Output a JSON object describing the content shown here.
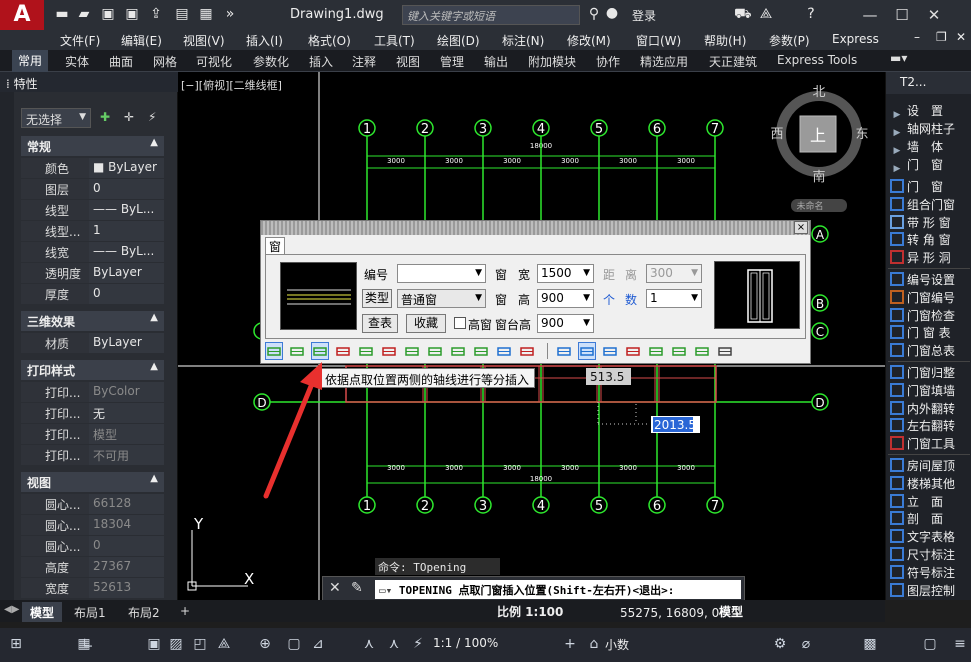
{
  "app": {
    "logo": "A",
    "doc_title": "Drawing1.dwg",
    "search_placeholder": "键入关键字或短语",
    "login": "登录"
  },
  "menu": [
    "文件(F)",
    "编辑(E)",
    "视图(V)",
    "插入(I)",
    "格式(O)",
    "工具(T)",
    "绘图(D)",
    "标注(N)",
    "修改(M)",
    "窗口(W)",
    "帮助(H)",
    "参数(P)",
    "Express"
  ],
  "ribbon_tabs": [
    "常用",
    "实体",
    "曲面",
    "网格",
    "可视化",
    "参数化",
    "插入",
    "注释",
    "视图",
    "管理",
    "输出",
    "附加模块",
    "协作",
    "精选应用",
    "天正建筑",
    "Express Tools"
  ],
  "properties": {
    "title": "特性",
    "selection": "无选择",
    "sections": [
      {
        "name": "常规",
        "rows": [
          [
            "颜色",
            "■ ByLayer"
          ],
          [
            "图层",
            "0"
          ],
          [
            "线型",
            "—— ByL..."
          ],
          [
            "线型...",
            "1"
          ],
          [
            "线宽",
            "—— ByL..."
          ],
          [
            "透明度",
            "ByLayer"
          ],
          [
            "厚度",
            "0"
          ]
        ]
      },
      {
        "name": "三维效果",
        "rows": [
          [
            "材质",
            "ByLayer"
          ]
        ]
      },
      {
        "name": "打印样式",
        "rows": [
          [
            "打印...",
            "ByColor"
          ],
          [
            "打印...",
            "无"
          ],
          [
            "打印...",
            "模型"
          ],
          [
            "打印...",
            "不可用"
          ]
        ]
      },
      {
        "name": "视图",
        "rows": [
          [
            "圆心...",
            "66128"
          ],
          [
            "圆心...",
            "18304"
          ],
          [
            "圆心...",
            "0"
          ],
          [
            "高度",
            "27367"
          ],
          [
            "宽度",
            "52613"
          ]
        ]
      }
    ]
  },
  "canvas": {
    "view_label": "[−][俯视][二维线框]",
    "viewcube": {
      "n": "北",
      "s": "南",
      "e": "东",
      "w": "西",
      "top": "上",
      "ucs": "未命名"
    },
    "axes_numbers": [
      "1",
      "2",
      "3",
      "4",
      "5",
      "6",
      "7"
    ],
    "axes_letters_right": [
      "A",
      "B",
      "C"
    ],
    "axis_letter_d": "D",
    "bay": "3000",
    "total": "18000",
    "dim1": "513.5",
    "dim2": "2013.5",
    "ucs_y": "Y",
    "ucs_x": "X"
  },
  "dialog": {
    "tab": "窗",
    "number_label": "编号",
    "number_value": "",
    "width_label1": "窗",
    "width_label2": "宽",
    "width_value": "1500",
    "dist_label1": "距",
    "dist_label2": "离",
    "dist_value": "300",
    "type_button": "类型",
    "type_value": "普通窗",
    "height_label1": "窗",
    "height_label2": "高",
    "height_value": "900",
    "count_label1": "个",
    "count_label2": "数",
    "count_value": "1",
    "table_button": "查表",
    "fav_button": "收藏",
    "high_window": "高窗",
    "sill_label": "窗台高",
    "sill_value": "900",
    "close": "×"
  },
  "tooltip": "依据点取位置两侧的轴线进行等分插入",
  "right_panel": {
    "title": "T2...",
    "top_items": [
      "设　置",
      "轴网柱子",
      "墙　体",
      "门　窗"
    ],
    "items": [
      "门　窗",
      "组合门窗",
      "带 形 窗",
      "转 角 窗",
      "异 形 洞",
      "编号设置",
      "门窗编号",
      "门窗检查",
      "门 窗 表",
      "门窗总表",
      "门窗归整",
      "门窗填墙",
      "内外翻转",
      "左右翻转",
      "门窗工具",
      "房间屋顶",
      "楼梯其他",
      "立　面",
      "剖　面",
      "文字表格",
      "尺寸标注",
      "符号标注",
      "图层控制"
    ]
  },
  "layout_tabs": [
    "模型",
    "布局1",
    "布局2"
  ],
  "command": {
    "history": "命令: TOpening",
    "prompt": "TOPENING 点取门窗插入位置(Shift-左右开)<退出>:"
  },
  "status": {
    "scale": "比例 1:100",
    "coords": "55275, 16809, 0",
    "model": "模型",
    "ratio": "1:1 / 100%",
    "units": "小数"
  }
}
